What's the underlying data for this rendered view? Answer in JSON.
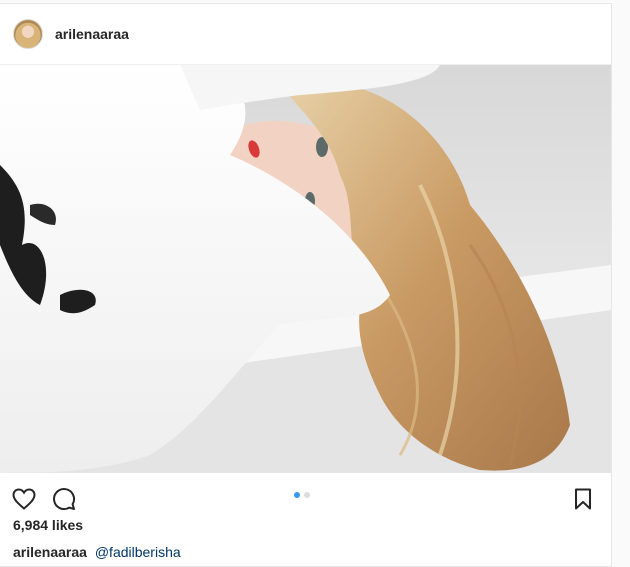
{
  "post": {
    "header": {
      "username": "arilenaaraa",
      "avatar_icon": "profile-photo-avatar"
    },
    "media": {
      "icon": "photo-fur-coat-blonde-model",
      "carousel": {
        "count": 2,
        "active_index": 0
      }
    },
    "actions": {
      "like_icon": "heart-icon",
      "comment_icon": "comment-icon",
      "save_icon": "bookmark-icon"
    },
    "likes_text": "6,984 likes",
    "caption": {
      "username": "arilenaaraa",
      "mention": "@fadilberisha"
    }
  },
  "colors": {
    "accent_blue": "#3897f0",
    "text": "#262626",
    "mention": "#003569",
    "border": "#e6e6e6"
  }
}
